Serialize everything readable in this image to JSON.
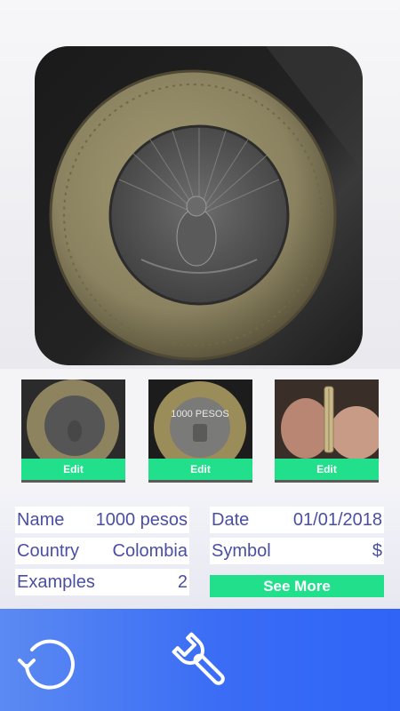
{
  "thumbnails": [
    {
      "edit_label": "Edit"
    },
    {
      "edit_label": "Edit"
    },
    {
      "edit_label": "Edit"
    }
  ],
  "details": {
    "name_label": "Name",
    "name_value": "1000 pesos",
    "date_label": "Date",
    "date_value": "01/01/2018",
    "country_label": "Country",
    "country_value": "Colombia",
    "symbol_label": "Symbol",
    "symbol_value": "$",
    "examples_label": "Examples",
    "examples_value": "2",
    "see_more_label": "See More"
  },
  "coin_face_text": "1000 PESOS",
  "toolbar": {
    "icons": [
      "reset-icon",
      "wrench-icon"
    ]
  },
  "colors": {
    "accent_green": "#22df8c",
    "label_text": "#4a4fa3",
    "toolbar_blue": "#3a6cf5"
  }
}
